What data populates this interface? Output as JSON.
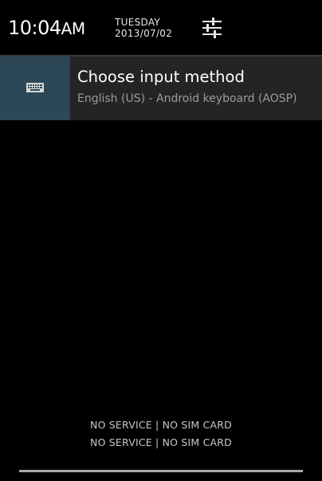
{
  "status_header": {
    "time": "10:04",
    "time_suffix": "AM",
    "day": "TUESDAY",
    "date": "2013/07/02",
    "settings_icon": "quick-settings-sliders-icon"
  },
  "notification": {
    "icon": "keyboard-icon",
    "title": "Choose input method",
    "text": "English (US) - Android keyboard (AOSP)",
    "icon_bg_color": "#2c4756"
  },
  "carrier_labels": [
    "NO SERVICE | NO SIM CARD",
    "NO SERVICE | NO SIM CARD"
  ]
}
